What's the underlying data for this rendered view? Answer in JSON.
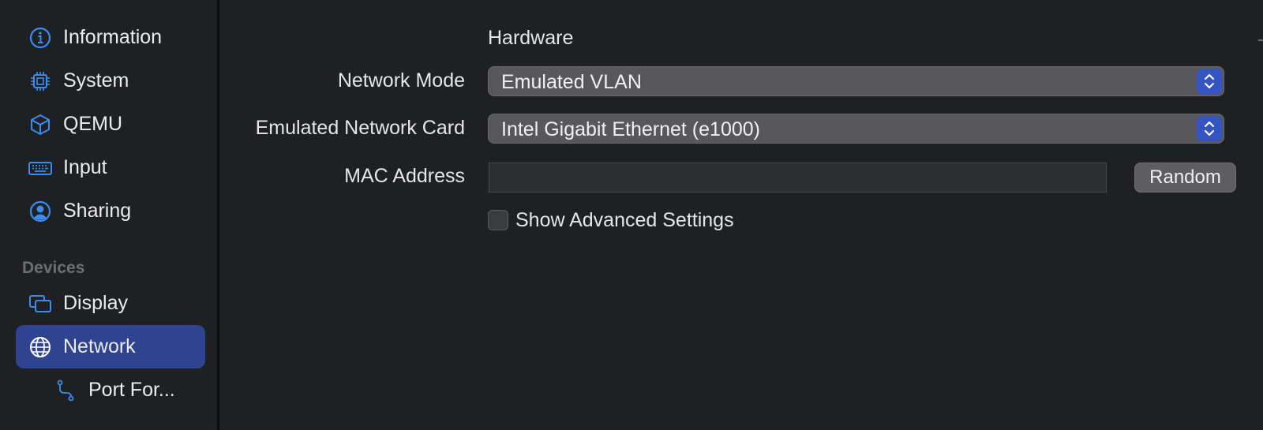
{
  "sidebar": {
    "items": [
      {
        "label": "Information",
        "icon": "info-circle-icon"
      },
      {
        "label": "System",
        "icon": "cpu-icon"
      },
      {
        "label": "QEMU",
        "icon": "cube-icon"
      },
      {
        "label": "Input",
        "icon": "keyboard-icon"
      },
      {
        "label": "Sharing",
        "icon": "person-circle-icon"
      }
    ],
    "devices_title": "Devices",
    "devices": [
      {
        "label": "Display",
        "icon": "display-windows-icon"
      },
      {
        "label": "Network",
        "icon": "globe-icon",
        "selected": true
      },
      {
        "label": "Port For...",
        "icon": "branch-icon",
        "indent": true
      }
    ]
  },
  "form": {
    "group_title": "Hardware",
    "network_mode": {
      "label": "Network Mode",
      "value": "Emulated VLAN"
    },
    "network_card": {
      "label": "Emulated Network Card",
      "value": "Intel Gigabit Ethernet (e1000)"
    },
    "mac_address": {
      "label": "MAC Address",
      "value": "",
      "button": "Random"
    },
    "advanced": {
      "label": "Show Advanced Settings",
      "checked": false
    }
  },
  "colors": {
    "accent": "#2f4490",
    "icon_blue": "#3b8cf0",
    "stepper": "#3454c4",
    "background": "#1f2024"
  }
}
